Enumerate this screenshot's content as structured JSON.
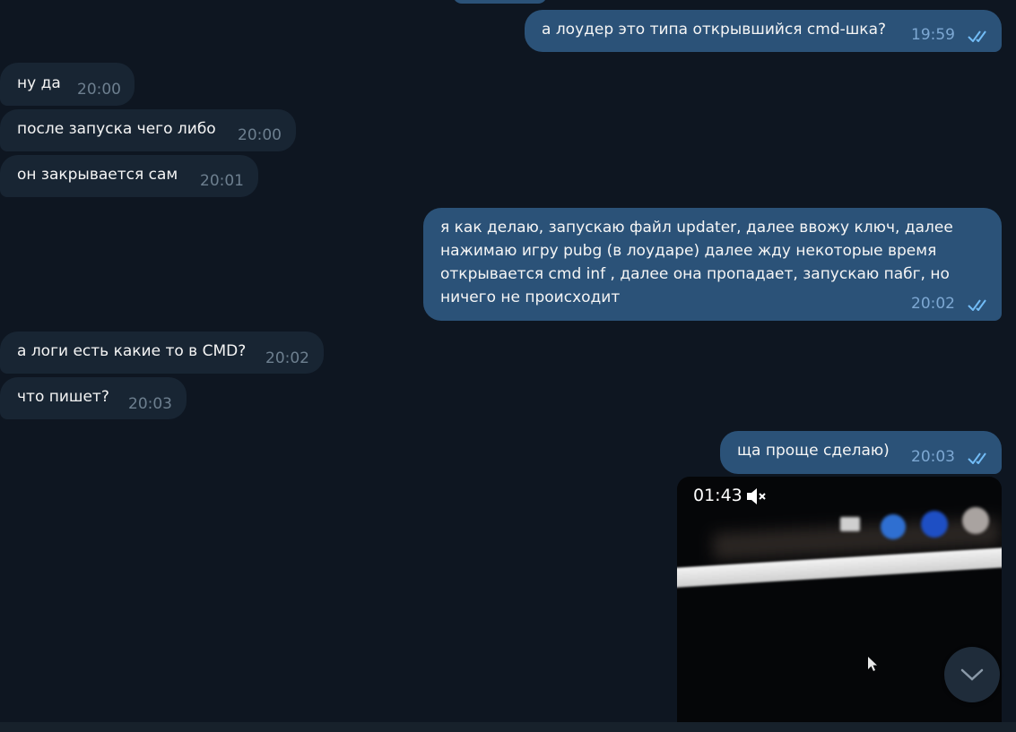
{
  "messages": [
    {
      "dir": "out",
      "text": "а лоудер это типа открывшийся cmd-шка?",
      "time": "19:59",
      "read": true
    },
    {
      "dir": "in",
      "text": "ну да",
      "time": "20:00"
    },
    {
      "dir": "in",
      "text": "после запуска чего либо",
      "time": "20:00"
    },
    {
      "dir": "in",
      "text": "он закрывается сам",
      "time": "20:01"
    },
    {
      "dir": "out",
      "lines": [
        "я как делаю, запускаю файл updater, далее ввожу ключ, далее",
        "нажимаю игру pubg (в лоударе) далее жду некоторые время",
        "открывается cmd inf , далее она пропадает, запускаю пабг, но",
        "ничего не происходит"
      ],
      "time": "20:02",
      "read": true
    },
    {
      "dir": "in",
      "text": "а логи есть какие то в CMD?",
      "time": "20:02"
    },
    {
      "dir": "in",
      "text": "что пишет?",
      "time": "20:03"
    },
    {
      "dir": "out",
      "text": "ща проще сделаю)",
      "time": "20:03",
      "read": true
    }
  ],
  "video": {
    "duration": "01:43",
    "muted": true
  },
  "colors": {
    "background": "#0e1621",
    "incoming_bubble": "#182533",
    "outgoing_bubble": "#2b5278",
    "read_check": "#72bcf6"
  }
}
